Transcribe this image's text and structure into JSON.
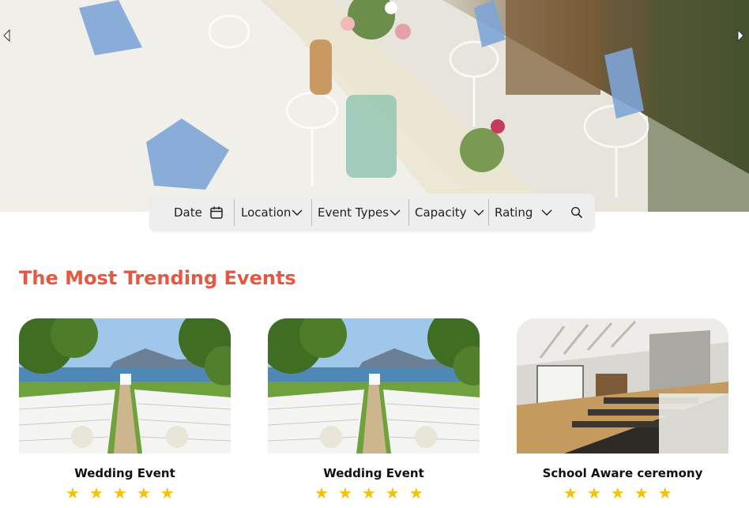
{
  "hero": {
    "image": "banquet-table-photo",
    "prev_icon": "chevron-left-icon",
    "next_icon": "chevron-right-icon"
  },
  "filters": {
    "date_label": "Date",
    "location_label": "Location",
    "event_types_label": "Event Types",
    "capacity_label": "Capacity",
    "rating_label": "Rating",
    "date_icon": "calendar-icon",
    "dropdown_icon": "chevron-down-icon",
    "search_icon": "search-icon"
  },
  "section": {
    "title": "The Most Trending Events",
    "title_color": "#e8573f"
  },
  "events": [
    {
      "title": "Wedding Event",
      "image": "lakeside-wedding-photo",
      "rating": 5
    },
    {
      "title": "Wedding Event",
      "image": "lakeside-wedding-photo",
      "rating": 5
    },
    {
      "title": "School Aware ceremony",
      "image": "lecture-hall-photo",
      "rating": 5
    }
  ],
  "colors": {
    "accent": "#e8573f",
    "star": "#f4c20d",
    "filter_bg": "#eeeeee"
  }
}
